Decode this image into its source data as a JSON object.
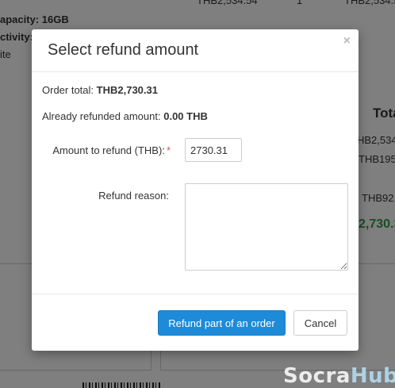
{
  "background": {
    "capacity": "apacity: 16GB",
    "activity": "ctivity:",
    "ite": "ite",
    "top_amount_1": "THB2,534.54",
    "top_qty": "1",
    "top_amount_2": "THB2,534.54",
    "totals_header": "Tota",
    "subtotal": "HB2,534.",
    "shipping": "THB195.",
    "tax": "THB92.",
    "grand_total": "2,730.3"
  },
  "modal": {
    "title": "Select refund amount",
    "close_symbol": "×",
    "order_total_label": "Order total:",
    "order_total_value": "THB2,730.31",
    "already_refunded_label": "Already refunded amount:",
    "already_refunded_value": "0.00 THB",
    "amount_label": "Amount to refund (THB):",
    "required_mark": "*",
    "amount_value": "2730.31",
    "reason_label": "Refund reason:",
    "reason_value": "",
    "primary_button": "Refund part of an order",
    "cancel_button": "Cancel"
  },
  "watermark": {
    "left": "Socra",
    "right": "Hub"
  },
  "colors": {
    "primary": "#1e8bd8",
    "required": "#d9534f",
    "grand_total": "#2e9b4e"
  }
}
